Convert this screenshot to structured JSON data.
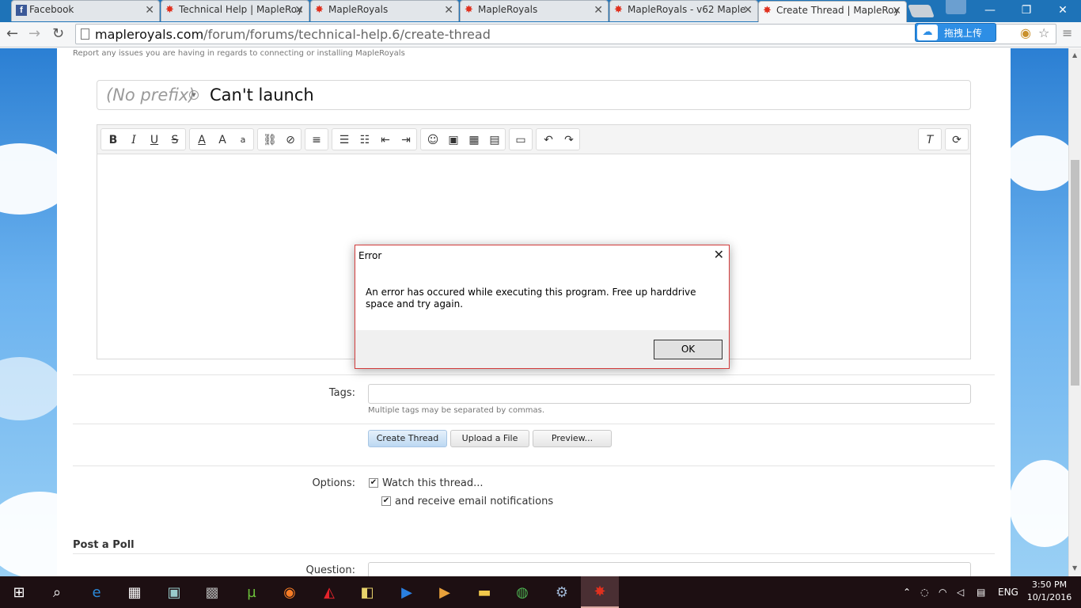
{
  "browser": {
    "tabs": [
      {
        "label": "Facebook",
        "icon": "facebook-icon"
      },
      {
        "label": "Technical Help | MapleRoy",
        "icon": "maple-leaf-icon"
      },
      {
        "label": "MapleRoyals",
        "icon": "maple-leaf-icon"
      },
      {
        "label": "MapleRoyals",
        "icon": "maple-leaf-icon"
      },
      {
        "label": "MapleRoyals - v62 Maple",
        "icon": "maple-leaf-icon"
      },
      {
        "label": "Create Thread | MapleRoy",
        "icon": "maple-leaf-icon"
      }
    ],
    "url_host": "mapleroyals.com",
    "url_path": "/forum/forums/technical-help.6/create-thread",
    "extension_label": "拖拽上传"
  },
  "forum": {
    "subtitle": "Report any issues you are having in regards to connecting or installing MapleRoyals",
    "prefix_placeholder": "(No prefix)",
    "thread_title": "Can't launch",
    "tags_label": "Tags:",
    "tags_hint": "Multiple tags may be separated by commas.",
    "buttons": {
      "create": "Create Thread",
      "upload": "Upload a File",
      "preview": "Preview..."
    },
    "options_label": "Options:",
    "watch_label": "Watch this thread...",
    "email_label": "and receive email notifications",
    "watch_checked": true,
    "email_checked": true,
    "poll_heading": "Post a Poll",
    "question_label": "Question:"
  },
  "dialog": {
    "title": "Error",
    "message": "An error has occured while executing this program. Free up harddrive space and try again.",
    "ok_label": "OK"
  },
  "taskbar": {
    "lang": "ENG",
    "time": "3:50 PM",
    "date": "10/1/2016"
  },
  "colors": {
    "chrome_frame": "#1e73b8",
    "dialog_border": "#d33c3c",
    "taskbar": "#1d0f12"
  }
}
